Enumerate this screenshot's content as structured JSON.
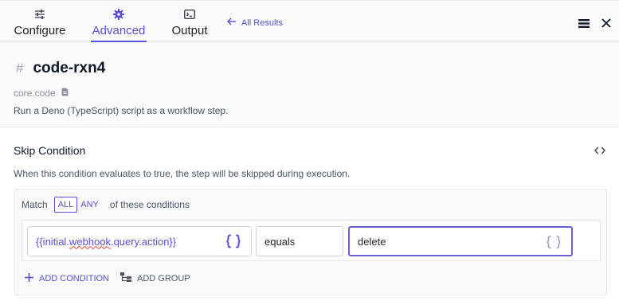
{
  "tabs": [
    {
      "label": "Configure",
      "icon": "sliders-icon",
      "active": false
    },
    {
      "label": "Advanced",
      "icon": "gear-icon",
      "active": true
    },
    {
      "label": "Output",
      "icon": "terminal-icon",
      "active": false
    }
  ],
  "back_link": {
    "label": "All Results",
    "icon": "arrow-left-icon"
  },
  "top_actions": {
    "menu_icon": "hamburger-icon",
    "close_icon": "close-icon"
  },
  "node": {
    "title": "code-rxn4",
    "type": "core.code",
    "description": "Run a Deno (TypeScript) script as a workflow step."
  },
  "skip_condition": {
    "title": "Skip Condition",
    "description": "When this condition evaluates to true, the step will be skipped during execution.",
    "match_label": "Match",
    "match_options": [
      "ALL",
      "ANY"
    ],
    "match_selected": "ALL",
    "match_suffix": "of these conditions",
    "condition": {
      "lhs_prefix": "{{initial.",
      "lhs_underlined": "webhook",
      "lhs_suffix": ".query.action}}",
      "operator": "equals",
      "rhs": "delete"
    },
    "add_condition_label": "ADD CONDITION",
    "add_group_label": "ADD GROUP"
  },
  "colors": {
    "accent": "#5b4fd9",
    "error_underline": "#e0443a",
    "panel_bg": "#fafafa"
  }
}
